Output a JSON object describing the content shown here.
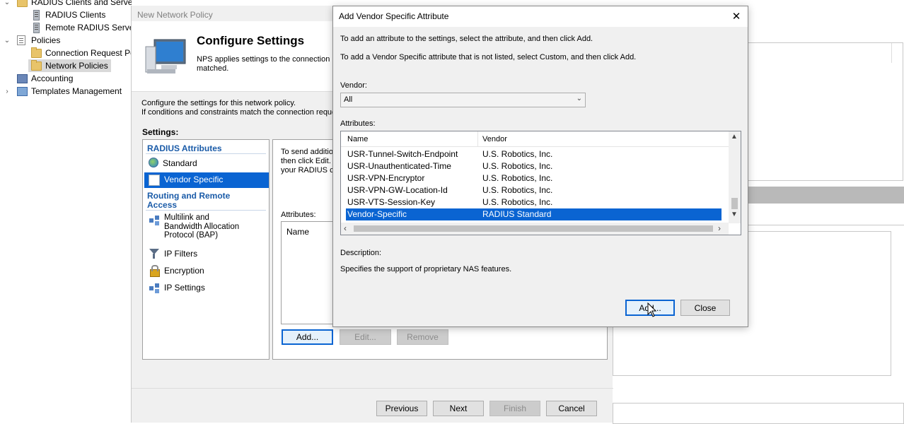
{
  "tree": {
    "items": [
      {
        "label": "RADIUS Clients and Servers",
        "icon": "folder-icon"
      },
      {
        "label": "RADIUS Clients",
        "icon": "server-icon"
      },
      {
        "label": "Remote RADIUS Server",
        "icon": "server-icon"
      },
      {
        "label": "Policies",
        "icon": "policy-icon"
      },
      {
        "label": "Connection Request Po",
        "icon": "folder-icon"
      },
      {
        "label": "Network Policies",
        "icon": "folder-icon"
      },
      {
        "label": "Accounting",
        "icon": "accounting-icon"
      },
      {
        "label": "Templates Management",
        "icon": "templates-icon"
      }
    ]
  },
  "wizard": {
    "window_title": "New Network Policy",
    "heading": "Configure Settings",
    "header_desc_line1": "NPS applies settings to the connection",
    "header_desc_line2": "matched.",
    "intro_line1": "Configure the settings for this network policy.",
    "intro_line2": "If conditions and constraints match the connection reques",
    "settings_label": "Settings:",
    "groups": {
      "radius_attributes": "RADIUS Attributes",
      "routing_line1": "Routing and Remote",
      "routing_line2": "Access"
    },
    "items": {
      "standard": "Standard",
      "vendor_specific": "Vendor Specific",
      "multilink_line1": "Multilink and",
      "multilink_line2": "Bandwidth Allocation",
      "multilink_line3": "Protocol (BAP)",
      "ip_filters": "IP Filters",
      "encryption": "Encryption",
      "ip_settings": "IP Settings"
    },
    "right_desc_line1": "To send additio",
    "right_desc_line2": "then click Edit.",
    "right_desc_line3": "your RADIUS cl",
    "attributes_label": "Attributes:",
    "name_column": "Name",
    "buttons": {
      "add": "Add...",
      "edit": "Edit...",
      "remove": "Remove",
      "previous": "Previous",
      "next": "Next",
      "finish": "Finish",
      "cancel": "Cancel"
    }
  },
  "dialog": {
    "title": "Add Vendor Specific Attribute",
    "close_glyph": "✕",
    "instruction1": "To add an attribute to the settings, select the attribute, and then click Add.",
    "instruction2": "To add a Vendor Specific attribute that is not listed, select Custom, and then click Add.",
    "vendor_label": "Vendor:",
    "vendor_value": "All",
    "attributes_label": "Attributes:",
    "columns": {
      "name": "Name",
      "vendor": "Vendor"
    },
    "rows": [
      {
        "name": "USR-Tunnel-Switch-Endpoint",
        "vendor": "U.S. Robotics, Inc."
      },
      {
        "name": "USR-Unauthenticated-Time",
        "vendor": "U.S. Robotics, Inc."
      },
      {
        "name": "USR-VPN-Encryptor",
        "vendor": "U.S. Robotics, Inc."
      },
      {
        "name": "USR-VPN-GW-Location-Id",
        "vendor": "U.S. Robotics, Inc."
      },
      {
        "name": "USR-VTS-Session-Key",
        "vendor": "U.S. Robotics, Inc."
      },
      {
        "name": "Vendor-Specific",
        "vendor": "RADIUS Standard"
      }
    ],
    "selected_row": 5,
    "description_label": "Description:",
    "description": "Specifies the support of proprietary NAS features.",
    "buttons": {
      "add": "Add...",
      "close": "Close"
    }
  },
  "colors": {
    "selection": "#0a64d2",
    "group_header": "#1a5ba8"
  }
}
